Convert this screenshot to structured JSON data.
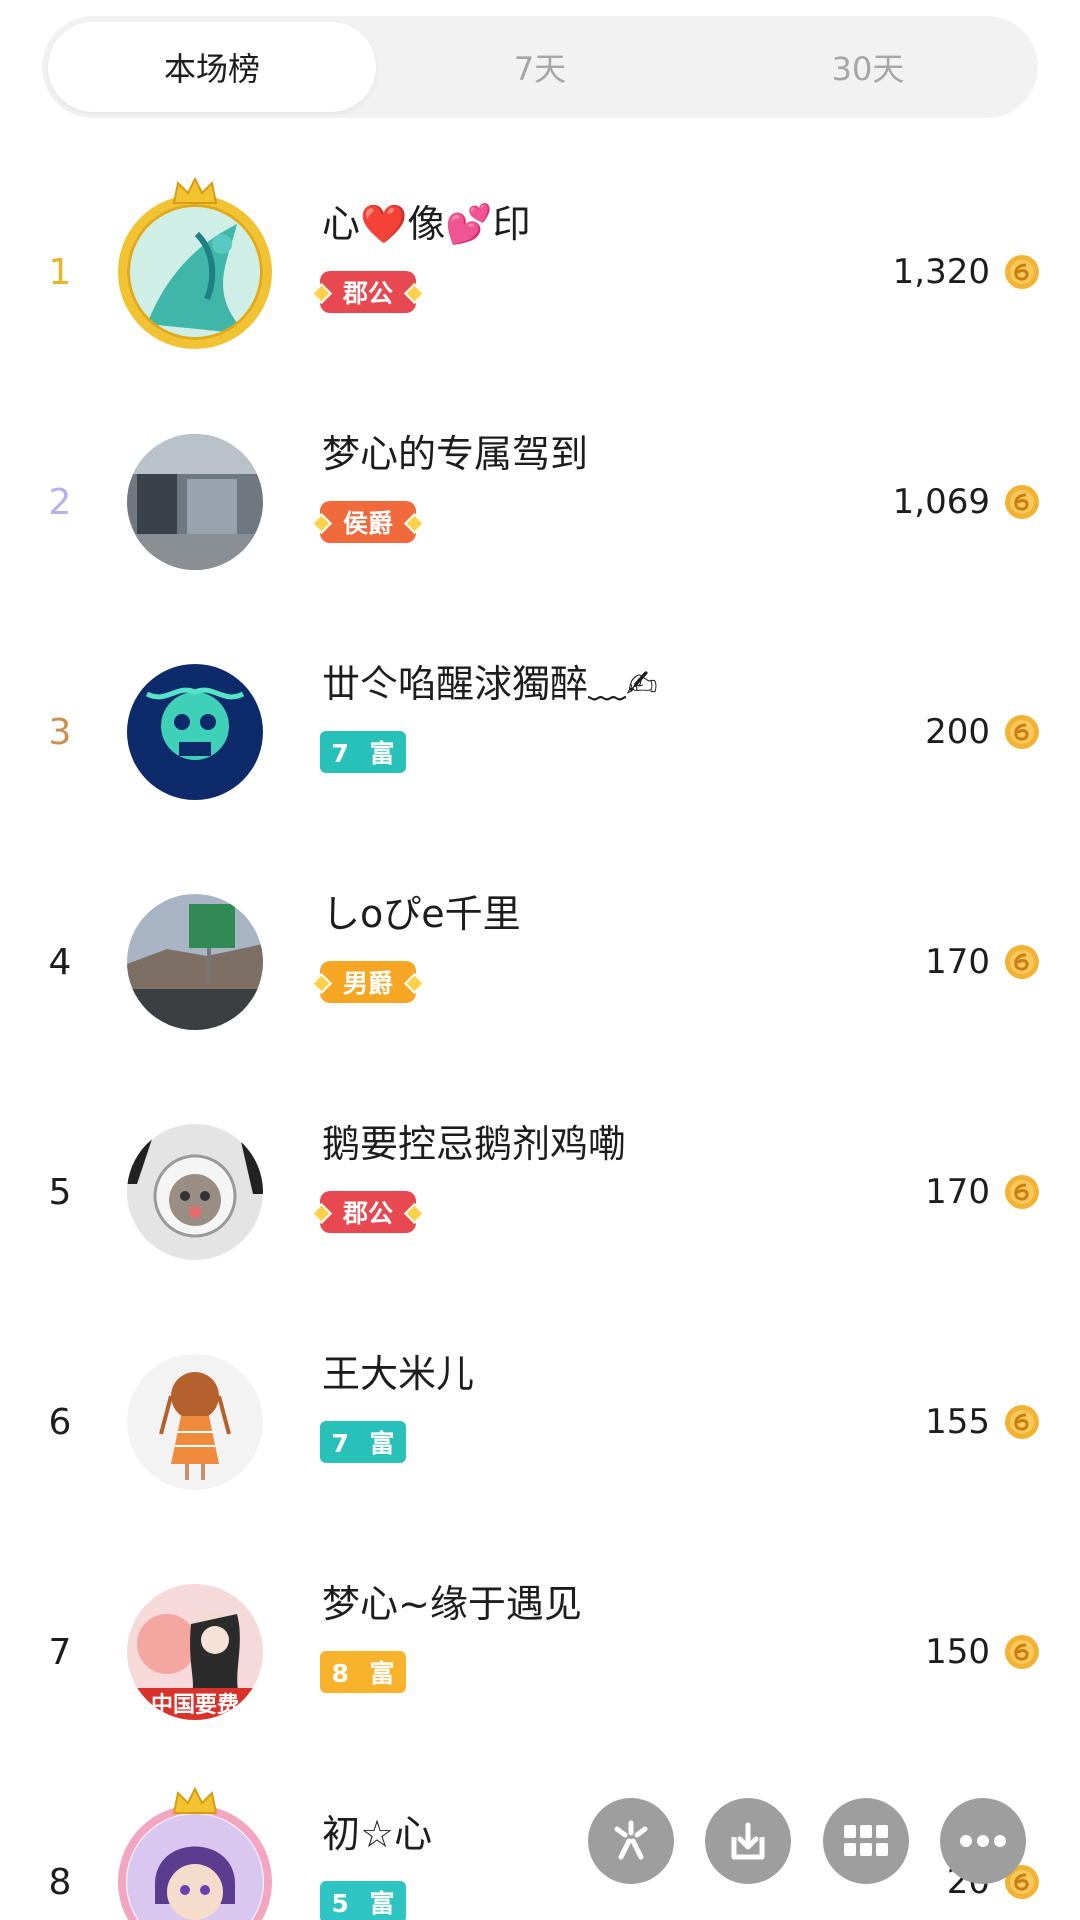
{
  "tabs": [
    {
      "label": "本场榜",
      "active": true
    },
    {
      "label": "7天",
      "active": false
    },
    {
      "label": "30天",
      "active": false
    }
  ],
  "rank_colors": {
    "1": "#e8b526",
    "2": "#b7b0ee",
    "3": "#cc8f4e",
    "default": "#1d1d1d"
  },
  "badge_colors": {
    "郡公": "#e8484f",
    "侯爵": "#f06a3c",
    "男爵": "#f5a623",
    "7 富": "#27c1b9",
    "8 富": "#f8b22c",
    "5 富": "#2fc4c4"
  },
  "rows": [
    {
      "rank": "1",
      "name": "心❤️像💕印",
      "badge": "郡公",
      "badge_kind": "noble",
      "score": "1,320"
    },
    {
      "rank": "2",
      "name": "梦心的专属驾到",
      "badge": "侯爵",
      "badge_kind": "noble",
      "score": "1,069"
    },
    {
      "rank": "3",
      "name": "丗仒啗醒浗獨醉﹏✍",
      "badge": "7 富",
      "badge_kind": "rich",
      "score": "200"
    },
    {
      "rank": "4",
      "name": "しoぴe千里",
      "badge": "男爵",
      "badge_kind": "noble",
      "score": "170"
    },
    {
      "rank": "5",
      "name": "鹅要控忌鹅剂鸡嘞",
      "badge": "郡公",
      "badge_kind": "noble",
      "score": "170"
    },
    {
      "rank": "6",
      "name": "王大米儿",
      "badge": "7 富",
      "badge_kind": "rich",
      "score": "155"
    },
    {
      "rank": "7",
      "name": "梦心~缘于遇见",
      "badge": "8 富",
      "badge_kind": "rich",
      "score": "150"
    },
    {
      "rank": "8",
      "name": "初☆心",
      "badge": "5 富",
      "badge_kind": "rich",
      "score": "20"
    }
  ],
  "avatar_text": {
    "row7": "中国要费"
  },
  "fabs": [
    "sparkle-icon",
    "download-icon",
    "grid-icon",
    "more-icon"
  ]
}
